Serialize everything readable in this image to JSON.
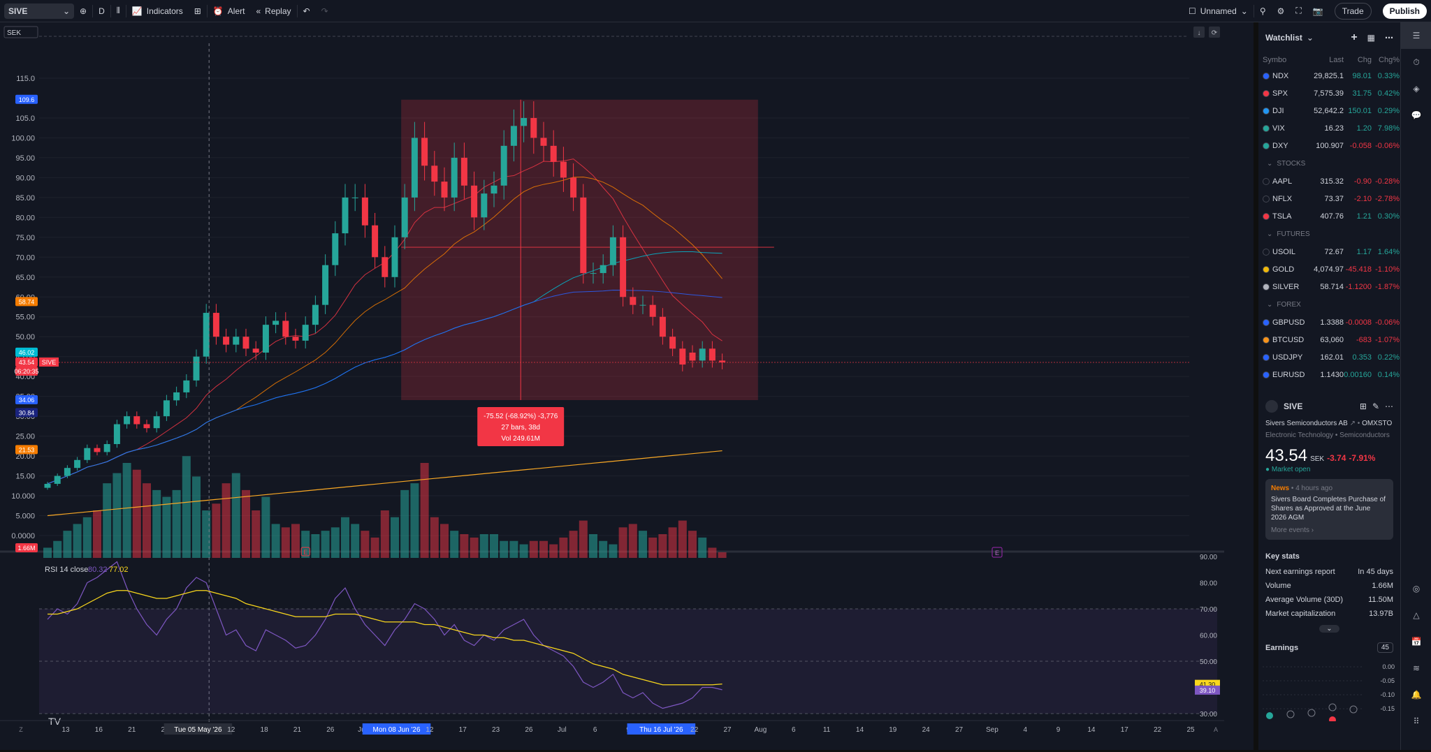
{
  "topbar": {
    "symbol": "SIVE",
    "interval": "D",
    "indicators_label": "Indicators",
    "alert_label": "Alert",
    "replay_label": "Replay",
    "layout_name": "Unnamed",
    "trade_label": "Trade",
    "publish_label": "Publish"
  },
  "chart": {
    "currency": "SEK",
    "price_levels": [
      "115.0",
      "105.0",
      "100.00",
      "95.00",
      "90.00",
      "85.00",
      "80.00",
      "75.00",
      "70.00",
      "65.00",
      "60.00",
      "55.00",
      "50.00",
      "45.00",
      "40.00",
      "35.00",
      "30.00",
      "25.00",
      "20.00",
      "15.00",
      "10.000",
      "5.000",
      "0.0000"
    ],
    "price_tags": [
      {
        "label": "109.6",
        "color": "#2962ff"
      },
      {
        "label": "58.74",
        "color": "#f57c00"
      },
      {
        "label": "46.02",
        "color": "#00bcd4"
      },
      {
        "label": "43.54",
        "color": "#f23645"
      },
      {
        "label": "06:20:35",
        "color": "#f23645"
      },
      {
        "label": "34.06",
        "color": "#2962ff"
      },
      {
        "label": "30.84",
        "color": "#1a237e"
      },
      {
        "label": "21.53",
        "color": "#f57c00"
      },
      {
        "label": "1.66M",
        "color": "#f23645"
      }
    ],
    "symbol_tag": "SIVE",
    "measure": {
      "line1": "-75.52 (-68.92%) -3,776",
      "line2": "27 bars, 38d",
      "line3": "Vol 249.61M"
    },
    "rsi_label": "RSI 14 close",
    "rsi_value_1": "80.32",
    "rsi_value_2": "77.02",
    "rsi_levels": [
      "90.00",
      "80.00",
      "70.00",
      "60.00",
      "50.00",
      "40.00",
      "30.00"
    ],
    "rsi_tags": [
      {
        "label": "41.30",
        "color": "#f9d71c"
      },
      {
        "label": "39.10",
        "color": "#7e57c2"
      }
    ],
    "earnings_marker": "E",
    "time_labels": [
      "13",
      "16",
      "21",
      "24",
      "Tue 05 May '26",
      "12",
      "18",
      "21",
      "26",
      "Jun",
      "Mon 08 Jun '26",
      "12",
      "17",
      "23",
      "26",
      "Jul",
      "6",
      "9",
      "Thu 16 Jul '26",
      "22",
      "27",
      "Aug",
      "6",
      "11",
      "14",
      "19",
      "24",
      "27",
      "Sep",
      "4",
      "9",
      "14",
      "17",
      "22",
      "25"
    ]
  },
  "chart_data": {
    "type": "candlestick",
    "x": [
      "Apr 10",
      "Apr 13",
      "Apr 14",
      "Apr 15",
      "Apr 16",
      "Apr 17",
      "Apr 20",
      "Apr 21",
      "Apr 22",
      "Apr 23",
      "Apr 24",
      "Apr 27",
      "Apr 28",
      "Apr 29",
      "Apr 30",
      "May 4",
      "May 5",
      "May 6",
      "May 7",
      "May 8",
      "May 11",
      "May 12",
      "May 13",
      "May 14",
      "May 15",
      "May 18",
      "May 19",
      "May 20",
      "May 21",
      "May 22",
      "May 25",
      "May 26",
      "May 27",
      "May 28",
      "May 29",
      "Jun 1",
      "Jun 2",
      "Jun 3",
      "Jun 4",
      "Jun 5",
      "Jun 8",
      "Jun 9",
      "Jun 10",
      "Jun 11",
      "Jun 12",
      "Jun 15",
      "Jun 16",
      "Jun 17",
      "Jun 18",
      "Jun 19",
      "Jun 22",
      "Jun 23",
      "Jun 24",
      "Jun 25",
      "Jun 26",
      "Jun 29",
      "Jun 30",
      "Jul 1",
      "Jul 2",
      "Jul 3",
      "Jul 6",
      "Jul 7",
      "Jul 8",
      "Jul 9",
      "Jul 10",
      "Jul 13",
      "Jul 14",
      "Jul 15",
      "Jul 16"
    ],
    "series": [
      {
        "name": "SIVE",
        "open": [
          12,
          13,
          15,
          17,
          19,
          22,
          21,
          23,
          28,
          30,
          28,
          27,
          30,
          34,
          36,
          39,
          45,
          56,
          50,
          48,
          50,
          47,
          46,
          53,
          54,
          50,
          49,
          53,
          58,
          68,
          76,
          85,
          85,
          78,
          70,
          65,
          75,
          85,
          100,
          93,
          89,
          85,
          95,
          88,
          80,
          86,
          88,
          98,
          103,
          105,
          100,
          98,
          94,
          90,
          85,
          66,
          66,
          68,
          75,
          60,
          58,
          58,
          55,
          50,
          47,
          46,
          44,
          47,
          44
        ],
        "close": [
          13,
          15,
          17,
          19,
          22,
          21,
          23,
          28,
          30,
          28,
          27,
          30,
          34,
          36,
          39,
          45,
          56,
          50,
          48,
          50,
          47,
          46,
          53,
          54,
          50,
          49,
          53,
          58,
          68,
          76,
          85,
          85,
          78,
          70,
          65,
          75,
          85,
          100,
          93,
          89,
          85,
          95,
          88,
          80,
          86,
          88,
          98,
          103,
          105,
          100,
          98,
          94,
          90,
          85,
          66,
          66,
          68,
          75,
          60,
          58,
          58,
          55,
          50,
          47,
          43,
          44,
          47,
          44,
          43.54
        ]
      },
      {
        "name": "Vol",
        "values": [
          3,
          5,
          8,
          10,
          12,
          14,
          22,
          25,
          28,
          26,
          22,
          20,
          18,
          20,
          30,
          24,
          14,
          16,
          22,
          25,
          20,
          14,
          18,
          10,
          9,
          10,
          8,
          7,
          8,
          9,
          12,
          10,
          8,
          6,
          14,
          12,
          20,
          22,
          28,
          12,
          10,
          8,
          7,
          6,
          7,
          7,
          5,
          5,
          4,
          5,
          5,
          4,
          6,
          8,
          11,
          7,
          5,
          4,
          9,
          10,
          8,
          6,
          7,
          9,
          11,
          8,
          6,
          3,
          1.66
        ]
      },
      {
        "name": "RSI 14",
        "values": [
          66,
          70,
          68,
          72,
          80,
          82,
          85,
          88,
          78,
          70,
          64,
          60,
          66,
          70,
          78,
          82,
          80,
          70,
          60,
          62,
          56,
          54,
          62,
          60,
          58,
          55,
          56,
          60,
          66,
          74,
          78,
          70,
          64,
          60,
          56,
          62,
          66,
          72,
          70,
          66,
          60,
          64,
          58,
          56,
          60,
          58,
          62,
          64,
          66,
          60,
          56,
          54,
          52,
          48,
          42,
          40,
          42,
          45,
          38,
          36,
          38,
          34,
          32,
          33,
          34,
          36,
          40,
          40,
          39.1
        ]
      },
      {
        "name": "RSI MA",
        "values": [
          68,
          68,
          69,
          70,
          72,
          74,
          76,
          77,
          77,
          76,
          75,
          74,
          74,
          75,
          76,
          77,
          77,
          76,
          75,
          74,
          72,
          71,
          70,
          69,
          68,
          67,
          67,
          67,
          67,
          68,
          68,
          68,
          67,
          66,
          65,
          65,
          65,
          65,
          64,
          64,
          63,
          62,
          61,
          60,
          60,
          59,
          59,
          58,
          58,
          57,
          56,
          55,
          54,
          53,
          51,
          49,
          48,
          47,
          45,
          44,
          43,
          42,
          41,
          41,
          41,
          41,
          41,
          41,
          41.3
        ]
      }
    ],
    "ylim": [
      0,
      115
    ],
    "rsi_ylim": [
      30,
      90
    ]
  },
  "watchlist": {
    "title": "Watchlist",
    "columns": [
      "Symbo",
      "Last",
      "Chg",
      "Chg%"
    ],
    "sections": [
      {
        "name": "",
        "rows": [
          {
            "sym": "NDX",
            "last": "29,825.1",
            "chg": "98.01",
            "pct": "0.33%",
            "dir": "pos",
            "color": "#2962ff"
          },
          {
            "sym": "SPX",
            "last": "7,575.39",
            "chg": "31.75",
            "pct": "0.42%",
            "dir": "pos",
            "color": "#f23645"
          },
          {
            "sym": "DJI",
            "last": "52,642.2",
            "chg": "150.01",
            "pct": "0.29%",
            "dir": "pos",
            "color": "#2196f3"
          },
          {
            "sym": "VIX",
            "last": "16.23",
            "chg": "1.20",
            "pct": "7.98%",
            "dir": "pos",
            "color": "#26a69a"
          },
          {
            "sym": "DXY",
            "last": "100.907",
            "chg": "-0.058",
            "pct": "-0.06%",
            "dir": "neg",
            "color": "#26a69a"
          }
        ]
      },
      {
        "name": "STOCKS",
        "rows": [
          {
            "sym": "AAPL",
            "last": "315.32",
            "chg": "-0.90",
            "pct": "-0.28%",
            "dir": "neg",
            "color": "#131722"
          },
          {
            "sym": "NFLX",
            "last": "73.37",
            "chg": "-2.10",
            "pct": "-2.78%",
            "dir": "neg",
            "color": "#131722"
          },
          {
            "sym": "TSLA",
            "last": "407.76",
            "chg": "1.21",
            "pct": "0.30%",
            "dir": "pos",
            "color": "#f23645"
          }
        ]
      },
      {
        "name": "FUTURES",
        "rows": [
          {
            "sym": "USOIL",
            "last": "72.67",
            "chg": "1.17",
            "pct": "1.64%",
            "dir": "pos",
            "color": "#131722"
          },
          {
            "sym": "GOLD",
            "last": "4,074.97",
            "chg": "-45.418",
            "pct": "-1.10%",
            "dir": "neg",
            "color": "#f0b90b"
          },
          {
            "sym": "SILVER",
            "last": "58.714",
            "chg": "-1.1200",
            "pct": "-1.87%",
            "dir": "neg",
            "color": "#b2b5be"
          }
        ]
      },
      {
        "name": "FOREX",
        "rows": [
          {
            "sym": "GBPUSD",
            "last": "1.3388",
            "chg": "-0.0008",
            "pct": "-0.06%",
            "dir": "neg",
            "color": "#2962ff"
          },
          {
            "sym": "BTCUSD",
            "last": "63,060",
            "chg": "-683",
            "pct": "-1.07%",
            "dir": "neg",
            "color": "#f7931a"
          },
          {
            "sym": "USDJPY",
            "last": "162.01",
            "chg": "0.353",
            "pct": "0.22%",
            "dir": "pos",
            "color": "#2962ff"
          },
          {
            "sym": "EURUSD",
            "last": "1.1430",
            "chg": "0.00160",
            "pct": "0.14%",
            "dir": "pos",
            "color": "#2962ff"
          }
        ]
      }
    ]
  },
  "detail": {
    "symbol": "SIVE",
    "name": "Sivers Semiconductors AB",
    "exchange": "OMXSTO",
    "sector": "Electronic Technology",
    "industry": "Semiconductors",
    "price": "43.54",
    "currency": "SEK",
    "change": "-3.74",
    "change_pct": "-7.91%",
    "market_status": "Market open",
    "news_source": "News",
    "news_time": "4 hours ago",
    "news_text": "Sivers Board Completes Purchase of Shares as Approved at the June 2026 AGM",
    "more_events": "More events ›",
    "key_stats_title": "Key stats",
    "stats": [
      {
        "label": "Next earnings report",
        "value": "In 45 days"
      },
      {
        "label": "Volume",
        "value": "1.66M"
      },
      {
        "label": "Average Volume (30D)",
        "value": "11.50M"
      },
      {
        "label": "Market capitalization",
        "value": "13.97B"
      }
    ],
    "earnings_title": "Earnings",
    "earnings_badge": "45",
    "earnings_levels": [
      "0.00",
      "-0.05",
      "-0.10",
      "-0.15"
    ]
  }
}
